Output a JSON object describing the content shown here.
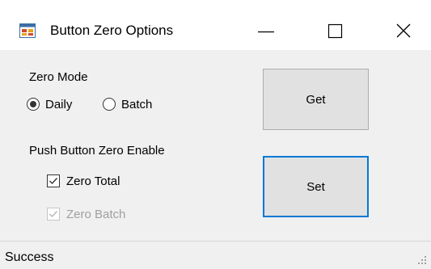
{
  "window": {
    "title": "Button Zero Options",
    "controls": {
      "minimize_icon": "minimize-icon",
      "maximize_icon": "maximize-icon",
      "close_icon": "close-icon"
    }
  },
  "zero_mode": {
    "label": "Zero Mode",
    "options": [
      {
        "label": "Daily",
        "checked": true
      },
      {
        "label": "Batch",
        "checked": false
      }
    ]
  },
  "push_button_zero": {
    "label": "Push Button Zero Enable",
    "options": [
      {
        "label": "Zero Total",
        "checked": true,
        "enabled": true
      },
      {
        "label": "Zero Batch",
        "checked": true,
        "enabled": false
      }
    ]
  },
  "buttons": {
    "get": "Get",
    "set": "Set"
  },
  "status": {
    "text": "Success"
  },
  "colors": {
    "focus_border": "#0078d7",
    "window_bg": "#f0f0f0",
    "disabled_text": "#a0a0a0"
  }
}
